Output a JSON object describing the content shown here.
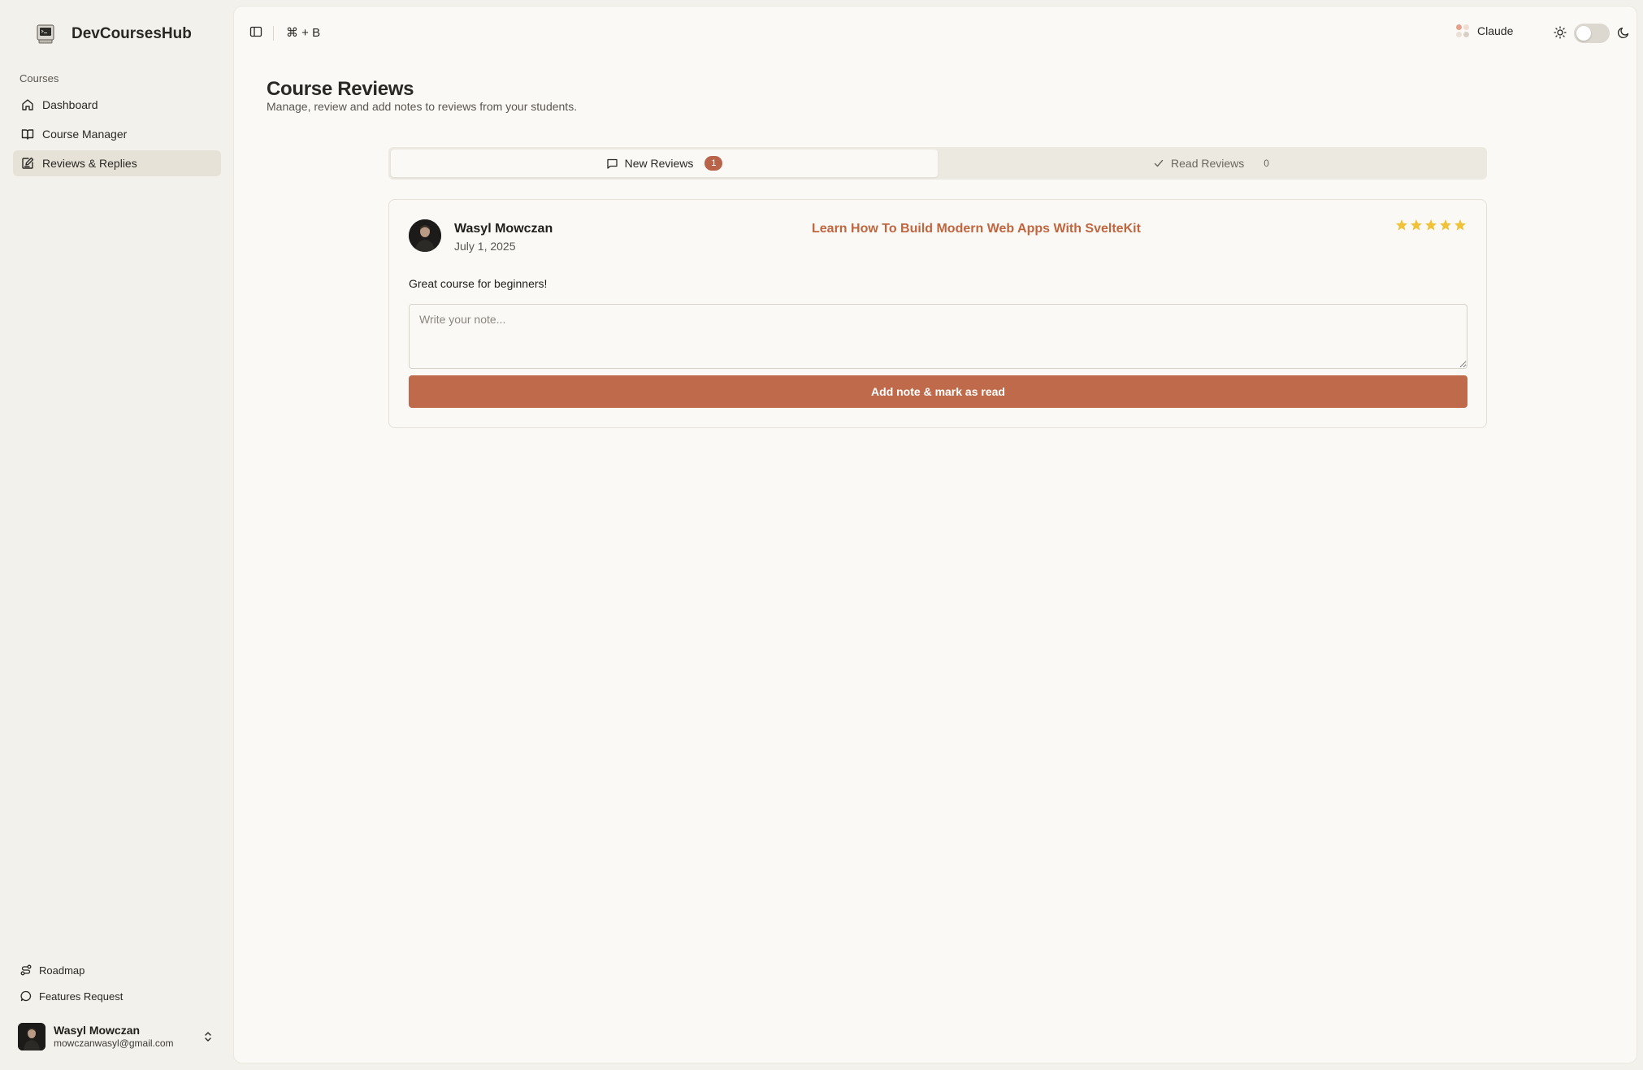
{
  "app": {
    "name": "DevCoursesHub"
  },
  "sidebar": {
    "section_label": "Courses",
    "items": [
      {
        "label": "Dashboard",
        "icon": "home-icon",
        "active": false
      },
      {
        "label": "Course Manager",
        "icon": "book-open-icon",
        "active": false
      },
      {
        "label": "Reviews & Replies",
        "icon": "edit-note-icon",
        "active": true
      }
    ],
    "bottom_links": [
      {
        "label": "Roadmap",
        "icon": "route-icon"
      },
      {
        "label": "Features Request",
        "icon": "message-circle-icon"
      }
    ],
    "user": {
      "name": "Wasyl Mowczan",
      "email": "mowczanwasyl@gmail.com"
    }
  },
  "topbar": {
    "shortcut": "⌘ + B",
    "theme_name": "Claude",
    "dark_mode": false,
    "theme_dot_colors": [
      "#d97757",
      "#e8c9b5",
      "#f1e4d8",
      "#c9bfb3"
    ]
  },
  "page": {
    "title": "Course Reviews",
    "subtitle": "Manage, review and add notes to reviews from your students."
  },
  "tabs": [
    {
      "label": "New Reviews",
      "count": "1",
      "icon": "message-square-icon",
      "active": true
    },
    {
      "label": "Read Reviews",
      "count": "0",
      "icon": "check-icon",
      "active": false
    }
  ],
  "review": {
    "reviewer": "Wasyl Mowczan",
    "date": "July 1, 2025",
    "course": "Learn How To Build Modern Web Apps With SvelteKit",
    "rating": 5,
    "max_rating": 5,
    "text": "Great course for beginners!",
    "note_placeholder": "Write your note...",
    "note_value": "",
    "submit_label": "Add note & mark as read"
  },
  "colors": {
    "accent": "#bf6b4b",
    "link": "#c0663f",
    "star": "#f0c23a",
    "badge": "#b9634a"
  }
}
